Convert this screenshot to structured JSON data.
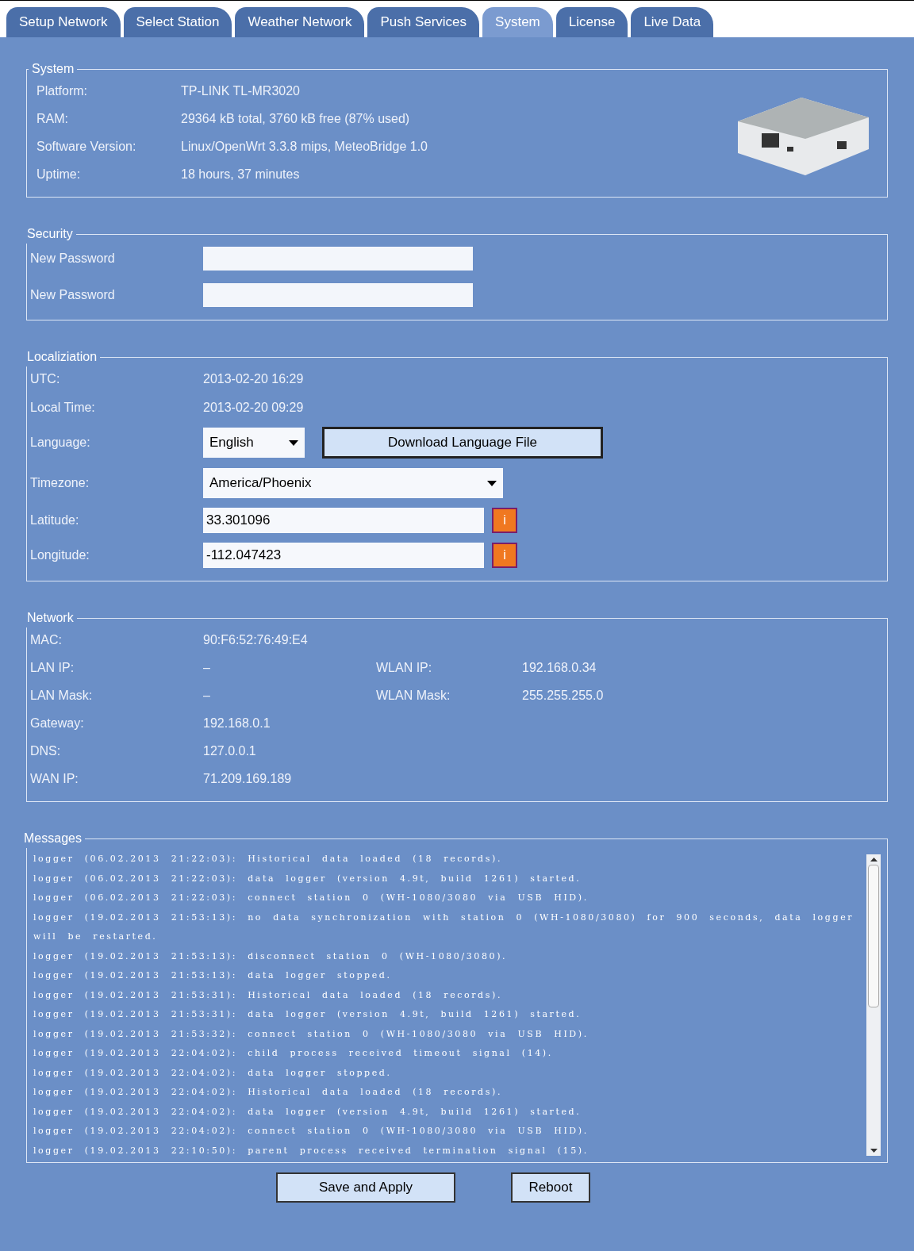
{
  "tabs": [
    {
      "label": "Setup Network",
      "selected": false
    },
    {
      "label": "Select Station",
      "selected": false
    },
    {
      "label": "Weather Network",
      "selected": false
    },
    {
      "label": "Push Services",
      "selected": false
    },
    {
      "label": "System",
      "selected": true
    },
    {
      "label": "License",
      "selected": false
    },
    {
      "label": "Live Data",
      "selected": false
    }
  ],
  "system": {
    "title": "System",
    "fields": [
      {
        "label": "Platform:",
        "value": "TP-LINK TL-MR3020"
      },
      {
        "label": "RAM:",
        "value": "29364 kB total, 3760 kB free (87% used)"
      },
      {
        "label": "Software Version:",
        "value": "Linux/OpenWrt 3.3.8 mips, MeteoBridge 1.0"
      },
      {
        "label": "Uptime:",
        "value": "18 hours, 37 minutes"
      }
    ]
  },
  "security": {
    "title": "Security",
    "fields": [
      {
        "label": "New Password"
      },
      {
        "label": "New Password"
      }
    ]
  },
  "localization": {
    "title": "Localiziation",
    "rows": [
      {
        "kind": "text",
        "label": "UTC:",
        "value": "2013-02-20 16:29"
      },
      {
        "kind": "text",
        "label": "Local Time:",
        "value": "2013-02-20 09:29"
      },
      {
        "kind": "language",
        "label": "Language:",
        "value": "English",
        "button": "Download Language File"
      },
      {
        "kind": "select",
        "label": "Timezone:",
        "value": "America/Phoenix"
      },
      {
        "kind": "input",
        "label": "Latitude:",
        "value": "33.301096",
        "info": "i"
      },
      {
        "kind": "input",
        "label": "Longitude:",
        "value": "-112.047423",
        "info": "i"
      }
    ]
  },
  "network": {
    "title": "Network",
    "rows": [
      [
        {
          "label": "MAC:",
          "value": "90:F6:52:76:49:E4"
        }
      ],
      [
        {
          "label": "LAN IP:",
          "value": "–"
        },
        {
          "label": "WLAN IP:",
          "value": "192.168.0.34"
        }
      ],
      [
        {
          "label": "LAN Mask:",
          "value": "–"
        },
        {
          "label": "WLAN Mask:",
          "value": "255.255.255.0"
        }
      ],
      [
        {
          "label": "Gateway:",
          "value": "192.168.0.1"
        }
      ],
      [
        {
          "label": "DNS:",
          "value": "127.0.0.1"
        }
      ],
      [
        {
          "label": "WAN IP:",
          "value": "71.209.169.189"
        }
      ]
    ]
  },
  "messages": {
    "title": "Messages",
    "lines": [
      "logger (06.02.2013 21:22:03): Historical data loaded (18 records).",
      "logger (06.02.2013 21:22:03): data logger (version 4.9t, build 1261) started.",
      "logger (06.02.2013 21:22:03): connect station 0 (WH-1080/3080 via USB HID).",
      "logger (19.02.2013 21:53:13): no data synchronization with station 0 (WH-1080/3080) for 900 seconds, data logger will be restarted.",
      "logger (19.02.2013 21:53:13): disconnect station 0 (WH-1080/3080).",
      "logger (19.02.2013 21:53:13): data logger stopped.",
      "logger (19.02.2013 21:53:31): Historical data loaded (18 records).",
      "logger (19.02.2013 21:53:31): data logger (version 4.9t, build 1261) started.",
      "logger (19.02.2013 21:53:32): connect station 0 (WH-1080/3080 via USB HID).",
      "logger (19.02.2013 22:04:02): child process received timeout signal (14).",
      "logger (19.02.2013 22:04:02): data logger stopped.",
      "logger (19.02.2013 22:04:02): Historical data loaded (18 records).",
      "logger (19.02.2013 22:04:02): data logger (version 4.9t, build 1261) started.",
      "logger (19.02.2013 22:04:02): connect station 0 (WH-1080/3080 via USB HID).",
      "logger (19.02.2013 22:10:50): parent process received termination signal (15)."
    ]
  },
  "buttons": [
    "Save and Apply",
    "Reboot"
  ]
}
